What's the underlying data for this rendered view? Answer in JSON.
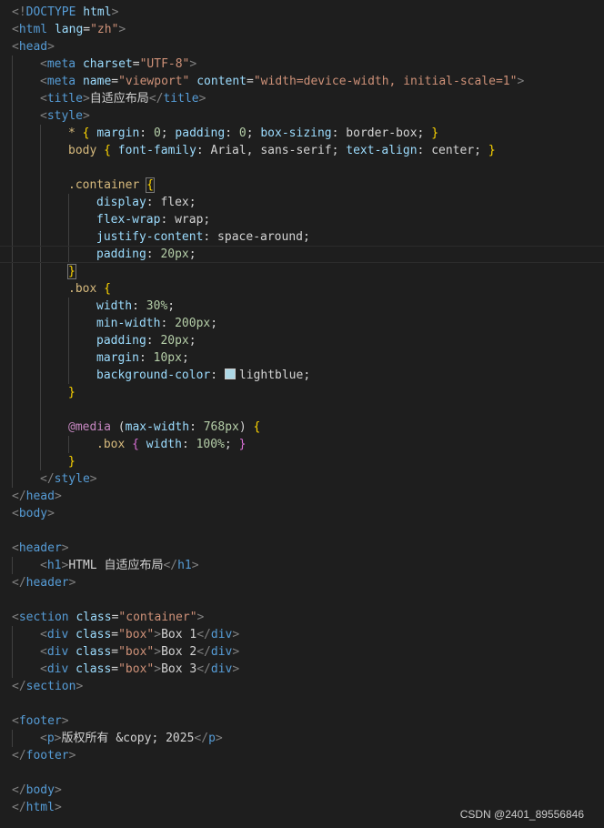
{
  "editor": {
    "lines": [
      {
        "indent": 0,
        "tokens": [
          {
            "t": "punct",
            "v": "<!"
          },
          {
            "t": "tag",
            "v": "DOCTYPE"
          },
          {
            "t": "text",
            "v": " "
          },
          {
            "t": "attr",
            "v": "html"
          },
          {
            "t": "punct",
            "v": ">"
          }
        ]
      },
      {
        "indent": 0,
        "tokens": [
          {
            "t": "punct",
            "v": "<"
          },
          {
            "t": "tag",
            "v": "html"
          },
          {
            "t": "text",
            "v": " "
          },
          {
            "t": "attr",
            "v": "lang"
          },
          {
            "t": "text",
            "v": "="
          },
          {
            "t": "str",
            "v": "\"zh\""
          },
          {
            "t": "punct",
            "v": ">"
          }
        ]
      },
      {
        "indent": 0,
        "tokens": [
          {
            "t": "punct",
            "v": "<"
          },
          {
            "t": "tag",
            "v": "head"
          },
          {
            "t": "punct",
            "v": ">"
          }
        ]
      },
      {
        "indent": 1,
        "tokens": [
          {
            "t": "punct",
            "v": "<"
          },
          {
            "t": "tag",
            "v": "meta"
          },
          {
            "t": "text",
            "v": " "
          },
          {
            "t": "attr",
            "v": "charset"
          },
          {
            "t": "text",
            "v": "="
          },
          {
            "t": "str",
            "v": "\"UTF-8\""
          },
          {
            "t": "punct",
            "v": ">"
          }
        ]
      },
      {
        "indent": 1,
        "tokens": [
          {
            "t": "punct",
            "v": "<"
          },
          {
            "t": "tag",
            "v": "meta"
          },
          {
            "t": "text",
            "v": " "
          },
          {
            "t": "attr",
            "v": "name"
          },
          {
            "t": "text",
            "v": "="
          },
          {
            "t": "str",
            "v": "\"viewport\""
          },
          {
            "t": "text",
            "v": " "
          },
          {
            "t": "attr",
            "v": "content"
          },
          {
            "t": "text",
            "v": "="
          },
          {
            "t": "str",
            "v": "\"width=device-width, initial-scale=1\""
          },
          {
            "t": "punct",
            "v": ">"
          }
        ]
      },
      {
        "indent": 1,
        "tokens": [
          {
            "t": "punct",
            "v": "<"
          },
          {
            "t": "tag",
            "v": "title"
          },
          {
            "t": "punct",
            "v": ">"
          },
          {
            "t": "text",
            "v": "自适应布局"
          },
          {
            "t": "punct",
            "v": "</"
          },
          {
            "t": "tag",
            "v": "title"
          },
          {
            "t": "punct",
            "v": ">"
          }
        ]
      },
      {
        "indent": 1,
        "tokens": [
          {
            "t": "punct",
            "v": "<"
          },
          {
            "t": "tag",
            "v": "style"
          },
          {
            "t": "punct",
            "v": ">"
          }
        ]
      },
      {
        "indent": 2,
        "tokens": [
          {
            "t": "sel",
            "v": "*"
          },
          {
            "t": "text",
            "v": " "
          },
          {
            "t": "brace",
            "v": "{"
          },
          {
            "t": "text",
            "v": " "
          },
          {
            "t": "prop",
            "v": "margin"
          },
          {
            "t": "text",
            "v": ": "
          },
          {
            "t": "num",
            "v": "0"
          },
          {
            "t": "text",
            "v": "; "
          },
          {
            "t": "prop",
            "v": "padding"
          },
          {
            "t": "text",
            "v": ": "
          },
          {
            "t": "num",
            "v": "0"
          },
          {
            "t": "text",
            "v": "; "
          },
          {
            "t": "prop",
            "v": "box-sizing"
          },
          {
            "t": "text",
            "v": ": border-box; "
          },
          {
            "t": "brace",
            "v": "}"
          }
        ]
      },
      {
        "indent": 2,
        "tokens": [
          {
            "t": "sel",
            "v": "body"
          },
          {
            "t": "text",
            "v": " "
          },
          {
            "t": "brace",
            "v": "{"
          },
          {
            "t": "text",
            "v": " "
          },
          {
            "t": "prop",
            "v": "font-family"
          },
          {
            "t": "text",
            "v": ": Arial, sans-serif; "
          },
          {
            "t": "prop",
            "v": "text-align"
          },
          {
            "t": "text",
            "v": ": center; "
          },
          {
            "t": "brace",
            "v": "}"
          }
        ]
      },
      {
        "indent": 2,
        "tokens": []
      },
      {
        "indent": 2,
        "tokens": [
          {
            "t": "sel",
            "v": ".container"
          },
          {
            "t": "text",
            "v": " "
          },
          {
            "t": "brace-box",
            "v": "{"
          }
        ]
      },
      {
        "indent": 3,
        "tokens": [
          {
            "t": "prop",
            "v": "display"
          },
          {
            "t": "text",
            "v": ": flex;"
          }
        ]
      },
      {
        "indent": 3,
        "tokens": [
          {
            "t": "prop",
            "v": "flex-wrap"
          },
          {
            "t": "text",
            "v": ": wrap;"
          }
        ]
      },
      {
        "indent": 3,
        "tokens": [
          {
            "t": "prop",
            "v": "justify-content"
          },
          {
            "t": "text",
            "v": ": space-around;"
          }
        ]
      },
      {
        "indent": 3,
        "current": true,
        "tokens": [
          {
            "t": "prop",
            "v": "padding"
          },
          {
            "t": "text",
            "v": ": "
          },
          {
            "t": "num",
            "v": "20px"
          },
          {
            "t": "text",
            "v": ";"
          }
        ]
      },
      {
        "indent": 2,
        "tokens": [
          {
            "t": "brace-box",
            "v": "}"
          }
        ]
      },
      {
        "indent": 2,
        "tokens": [
          {
            "t": "sel",
            "v": ".box"
          },
          {
            "t": "text",
            "v": " "
          },
          {
            "t": "brace",
            "v": "{"
          }
        ]
      },
      {
        "indent": 3,
        "tokens": [
          {
            "t": "prop",
            "v": "width"
          },
          {
            "t": "text",
            "v": ": "
          },
          {
            "t": "num",
            "v": "30%"
          },
          {
            "t": "text",
            "v": ";"
          }
        ]
      },
      {
        "indent": 3,
        "tokens": [
          {
            "t": "prop",
            "v": "min-width"
          },
          {
            "t": "text",
            "v": ": "
          },
          {
            "t": "num",
            "v": "200px"
          },
          {
            "t": "text",
            "v": ";"
          }
        ]
      },
      {
        "indent": 3,
        "tokens": [
          {
            "t": "prop",
            "v": "padding"
          },
          {
            "t": "text",
            "v": ": "
          },
          {
            "t": "num",
            "v": "20px"
          },
          {
            "t": "text",
            "v": ";"
          }
        ]
      },
      {
        "indent": 3,
        "tokens": [
          {
            "t": "prop",
            "v": "margin"
          },
          {
            "t": "text",
            "v": ": "
          },
          {
            "t": "num",
            "v": "10px"
          },
          {
            "t": "text",
            "v": ";"
          }
        ]
      },
      {
        "indent": 3,
        "tokens": [
          {
            "t": "prop",
            "v": "background-color"
          },
          {
            "t": "text",
            "v": ": "
          },
          {
            "t": "swatch",
            "v": ""
          },
          {
            "t": "text",
            "v": "lightblue;"
          }
        ]
      },
      {
        "indent": 2,
        "tokens": [
          {
            "t": "brace",
            "v": "}"
          }
        ]
      },
      {
        "indent": 2,
        "tokens": []
      },
      {
        "indent": 2,
        "tokens": [
          {
            "t": "at",
            "v": "@media"
          },
          {
            "t": "text",
            "v": " ("
          },
          {
            "t": "prop",
            "v": "max-width"
          },
          {
            "t": "text",
            "v": ": "
          },
          {
            "t": "num",
            "v": "768px"
          },
          {
            "t": "text",
            "v": ") "
          },
          {
            "t": "brace",
            "v": "{"
          }
        ]
      },
      {
        "indent": 3,
        "tokens": [
          {
            "t": "sel",
            "v": ".box"
          },
          {
            "t": "text",
            "v": " "
          },
          {
            "t": "brace2",
            "v": "{"
          },
          {
            "t": "text",
            "v": " "
          },
          {
            "t": "prop",
            "v": "width"
          },
          {
            "t": "text",
            "v": ": "
          },
          {
            "t": "num",
            "v": "100%"
          },
          {
            "t": "text",
            "v": "; "
          },
          {
            "t": "brace2",
            "v": "}"
          }
        ]
      },
      {
        "indent": 2,
        "tokens": [
          {
            "t": "brace",
            "v": "}"
          }
        ]
      },
      {
        "indent": 1,
        "tokens": [
          {
            "t": "punct",
            "v": "</"
          },
          {
            "t": "tag",
            "v": "style"
          },
          {
            "t": "punct",
            "v": ">"
          }
        ]
      },
      {
        "indent": 0,
        "tokens": [
          {
            "t": "punct",
            "v": "</"
          },
          {
            "t": "tag",
            "v": "head"
          },
          {
            "t": "punct",
            "v": ">"
          }
        ]
      },
      {
        "indent": 0,
        "tokens": [
          {
            "t": "punct",
            "v": "<"
          },
          {
            "t": "tag",
            "v": "body"
          },
          {
            "t": "punct",
            "v": ">"
          }
        ]
      },
      {
        "indent": 0,
        "tokens": []
      },
      {
        "indent": 0,
        "tokens": [
          {
            "t": "punct",
            "v": "<"
          },
          {
            "t": "tag",
            "v": "header"
          },
          {
            "t": "punct",
            "v": ">"
          }
        ]
      },
      {
        "indent": 1,
        "tokens": [
          {
            "t": "punct",
            "v": "<"
          },
          {
            "t": "tag",
            "v": "h1"
          },
          {
            "t": "punct",
            "v": ">"
          },
          {
            "t": "text",
            "v": "HTML 自适应布局"
          },
          {
            "t": "punct",
            "v": "</"
          },
          {
            "t": "tag",
            "v": "h1"
          },
          {
            "t": "punct",
            "v": ">"
          }
        ]
      },
      {
        "indent": 0,
        "tokens": [
          {
            "t": "punct",
            "v": "</"
          },
          {
            "t": "tag",
            "v": "header"
          },
          {
            "t": "punct",
            "v": ">"
          }
        ]
      },
      {
        "indent": 0,
        "tokens": []
      },
      {
        "indent": 0,
        "tokens": [
          {
            "t": "punct",
            "v": "<"
          },
          {
            "t": "tag",
            "v": "section"
          },
          {
            "t": "text",
            "v": " "
          },
          {
            "t": "attr",
            "v": "class"
          },
          {
            "t": "text",
            "v": "="
          },
          {
            "t": "str",
            "v": "\"container\""
          },
          {
            "t": "punct",
            "v": ">"
          }
        ]
      },
      {
        "indent": 1,
        "tokens": [
          {
            "t": "punct",
            "v": "<"
          },
          {
            "t": "tag",
            "v": "div"
          },
          {
            "t": "text",
            "v": " "
          },
          {
            "t": "attr",
            "v": "class"
          },
          {
            "t": "text",
            "v": "="
          },
          {
            "t": "str",
            "v": "\"box\""
          },
          {
            "t": "punct",
            "v": ">"
          },
          {
            "t": "text",
            "v": "Box 1"
          },
          {
            "t": "punct",
            "v": "</"
          },
          {
            "t": "tag",
            "v": "div"
          },
          {
            "t": "punct",
            "v": ">"
          }
        ]
      },
      {
        "indent": 1,
        "tokens": [
          {
            "t": "punct",
            "v": "<"
          },
          {
            "t": "tag",
            "v": "div"
          },
          {
            "t": "text",
            "v": " "
          },
          {
            "t": "attr",
            "v": "class"
          },
          {
            "t": "text",
            "v": "="
          },
          {
            "t": "str",
            "v": "\"box\""
          },
          {
            "t": "punct",
            "v": ">"
          },
          {
            "t": "text",
            "v": "Box 2"
          },
          {
            "t": "punct",
            "v": "</"
          },
          {
            "t": "tag",
            "v": "div"
          },
          {
            "t": "punct",
            "v": ">"
          }
        ]
      },
      {
        "indent": 1,
        "tokens": [
          {
            "t": "punct",
            "v": "<"
          },
          {
            "t": "tag",
            "v": "div"
          },
          {
            "t": "text",
            "v": " "
          },
          {
            "t": "attr",
            "v": "class"
          },
          {
            "t": "text",
            "v": "="
          },
          {
            "t": "str",
            "v": "\"box\""
          },
          {
            "t": "punct",
            "v": ">"
          },
          {
            "t": "text",
            "v": "Box 3"
          },
          {
            "t": "punct",
            "v": "</"
          },
          {
            "t": "tag",
            "v": "div"
          },
          {
            "t": "punct",
            "v": ">"
          }
        ]
      },
      {
        "indent": 0,
        "tokens": [
          {
            "t": "punct",
            "v": "</"
          },
          {
            "t": "tag",
            "v": "section"
          },
          {
            "t": "punct",
            "v": ">"
          }
        ]
      },
      {
        "indent": 0,
        "tokens": []
      },
      {
        "indent": 0,
        "tokens": [
          {
            "t": "punct",
            "v": "<"
          },
          {
            "t": "tag",
            "v": "footer"
          },
          {
            "t": "punct",
            "v": ">"
          }
        ]
      },
      {
        "indent": 1,
        "tokens": [
          {
            "t": "punct",
            "v": "<"
          },
          {
            "t": "tag",
            "v": "p"
          },
          {
            "t": "punct",
            "v": ">"
          },
          {
            "t": "text",
            "v": "版权所有 "
          },
          {
            "t": "entity",
            "v": "&copy;"
          },
          {
            "t": "text",
            "v": " 2025"
          },
          {
            "t": "punct",
            "v": "</"
          },
          {
            "t": "tag",
            "v": "p"
          },
          {
            "t": "punct",
            "v": ">"
          }
        ]
      },
      {
        "indent": 0,
        "tokens": [
          {
            "t": "punct",
            "v": "</"
          },
          {
            "t": "tag",
            "v": "footer"
          },
          {
            "t": "punct",
            "v": ">"
          }
        ]
      },
      {
        "indent": 0,
        "tokens": []
      },
      {
        "indent": 0,
        "tokens": [
          {
            "t": "punct",
            "v": "</"
          },
          {
            "t": "tag",
            "v": "body"
          },
          {
            "t": "punct",
            "v": ">"
          }
        ]
      },
      {
        "indent": 0,
        "tokens": [
          {
            "t": "punct",
            "v": "</"
          },
          {
            "t": "tag",
            "v": "html"
          },
          {
            "t": "punct",
            "v": ">"
          }
        ]
      }
    ]
  },
  "watermark": "CSDN @2401_89556846",
  "colors": {
    "background": "#1e1e1e",
    "tag": "#569cd6",
    "attribute": "#9cdcfe",
    "string": "#ce9178",
    "selector": "#d7ba7d",
    "brace": "#ffd700",
    "number": "#b5cea8",
    "at_rule": "#c586c0",
    "swatch_lightblue": "#add8e6"
  }
}
